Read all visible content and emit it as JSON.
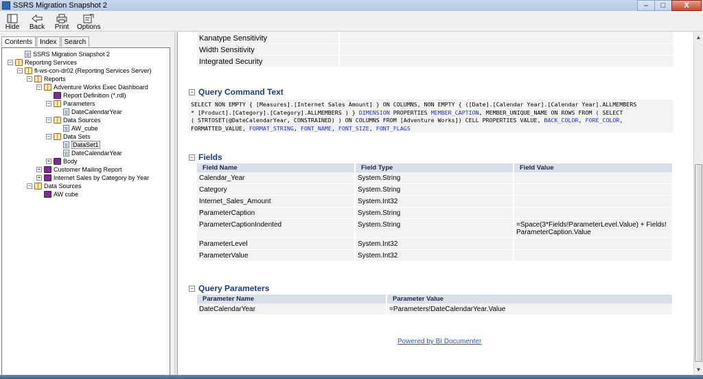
{
  "window": {
    "title": "SSRS Migration Snapshot 2",
    "controls": [
      "–",
      "□",
      "X"
    ]
  },
  "toolbar": {
    "buttons": [
      {
        "label": "Hide",
        "icon": "hide-icon"
      },
      {
        "label": "Back",
        "icon": "back-arrow-icon"
      },
      {
        "label": "Print",
        "icon": "printer-icon"
      },
      {
        "label": "Options",
        "icon": "options-icon"
      }
    ]
  },
  "navtabs": [
    "Contents",
    "Index",
    "Search"
  ],
  "tree": [
    {
      "label": "SSRS Migration Snapshot 2",
      "level": 1,
      "icon": "page",
      "toggle": ""
    },
    {
      "label": "Reporting Services",
      "level": 0,
      "icon": "open",
      "toggle": "-"
    },
    {
      "label": "fl-ws-con-dr02 (Reporting Services Server)",
      "level": 1,
      "icon": "open",
      "toggle": "-"
    },
    {
      "label": "Reports",
      "level": 2,
      "icon": "open",
      "toggle": "-"
    },
    {
      "label": "Adventure Works Exec Dashboard",
      "level": 3,
      "icon": "open",
      "toggle": "-"
    },
    {
      "label": "Report Definition (*.rdl)",
      "level": 4,
      "icon": "closed",
      "toggle": ""
    },
    {
      "label": "Parameters",
      "level": 4,
      "icon": "open",
      "toggle": "-"
    },
    {
      "label": "DateCalendarYear",
      "level": 5,
      "icon": "page",
      "toggle": ""
    },
    {
      "label": "Data Sources",
      "level": 4,
      "icon": "open",
      "toggle": "-"
    },
    {
      "label": "AW_cube",
      "level": 5,
      "icon": "page",
      "toggle": ""
    },
    {
      "label": "Data Sets",
      "level": 4,
      "icon": "open",
      "toggle": "-"
    },
    {
      "label": "DataSet1",
      "level": 5,
      "icon": "page",
      "toggle": "",
      "selected": true
    },
    {
      "label": "DateCalendarYear",
      "level": 5,
      "icon": "page",
      "toggle": ""
    },
    {
      "label": "Body",
      "level": 4,
      "icon": "closed",
      "toggle": "+"
    },
    {
      "label": "Customer Mailing Report",
      "level": 3,
      "icon": "closed",
      "toggle": "+"
    },
    {
      "label": "Internet Sales by Category by Year",
      "level": 3,
      "icon": "closed",
      "toggle": "+"
    },
    {
      "label": "Data Sources",
      "level": 2,
      "icon": "open",
      "toggle": "-"
    },
    {
      "label": "AW cube",
      "level": 3,
      "icon": "closed",
      "toggle": ""
    }
  ],
  "properties": [
    {
      "name": "Kanatype Sensitivity",
      "value": ""
    },
    {
      "name": "Width Sensitivity",
      "value": ""
    },
    {
      "name": "Integrated Security",
      "value": ""
    }
  ],
  "query_command": {
    "heading": "Query Command Text",
    "lines": [
      [
        {
          "t": "SELECT NON EMPTY { [Measures].[Internet Sales Amount] } ON COLUMNS, NON EMPTY { ([Date].[Calendar Year].[Calendar Year].ALLMEMBERS"
        }
      ],
      [
        {
          "t": "* [Product].[Category].[Category].ALLMEMBERS ) } "
        },
        {
          "t": "DIMENSION",
          "k": 1
        },
        {
          "t": " PROPERTIES "
        },
        {
          "t": "MEMBER_CAPTION",
          "k": 1
        },
        {
          "t": ", MEMBER_UNIQUE_NAME ON ROWS FROM ( SELECT"
        }
      ],
      [
        {
          "t": "( STRTOSET(@DateCalendarYear, CONSTRAINED) ) ON COLUMNS FROM [Adventure Works]) CELL PROPERTIES VALUE, "
        },
        {
          "t": "BACK_COLOR",
          "k": 1
        },
        {
          "t": ", "
        },
        {
          "t": "FORE_COLOR",
          "k": 1
        },
        {
          "t": ","
        }
      ],
      [
        {
          "t": "FORMATTED_VALUE, "
        },
        {
          "t": "FORMAT_STRING",
          "k": 1
        },
        {
          "t": ", "
        },
        {
          "t": "FONT_NAME",
          "k": 1
        },
        {
          "t": ", "
        },
        {
          "t": "FONT_SIZE",
          "k": 1
        },
        {
          "t": ", "
        },
        {
          "t": "FONT_FLAGS",
          "k": 1
        }
      ]
    ]
  },
  "fields": {
    "heading": "Fields",
    "columns": [
      "Field Name",
      "Field Type",
      "Field Value"
    ],
    "rows": [
      [
        "Calendar_Year",
        "System.String",
        ""
      ],
      [
        "Category",
        "System.String",
        ""
      ],
      [
        "Internet_Sales_Amount",
        "System.Int32",
        ""
      ],
      [
        "ParameterCaption",
        "System.String",
        ""
      ],
      [
        "ParameterCaptionIndented",
        "System.String",
        "=Space(3*Fields!ParameterLevel.Value) + Fields!\nParameterCaption.Value"
      ],
      [
        "ParameterLevel",
        "System.Int32",
        ""
      ],
      [
        "ParameterValue",
        "System.Int32",
        ""
      ]
    ]
  },
  "query_parameters": {
    "heading": "Query Parameters",
    "columns": [
      "Parameter Name",
      "Parameter Value"
    ],
    "rows": [
      [
        "DateCalendarYear",
        "=Parameters!DateCalendarYear.Value"
      ]
    ]
  },
  "footer": {
    "link": "Powered by BI Documenter"
  },
  "colors": {
    "heading": "#1c3f82",
    "keyword": "#1f2fd6",
    "link": "#1f5fd0",
    "header_bg": "#d8dfe9"
  }
}
